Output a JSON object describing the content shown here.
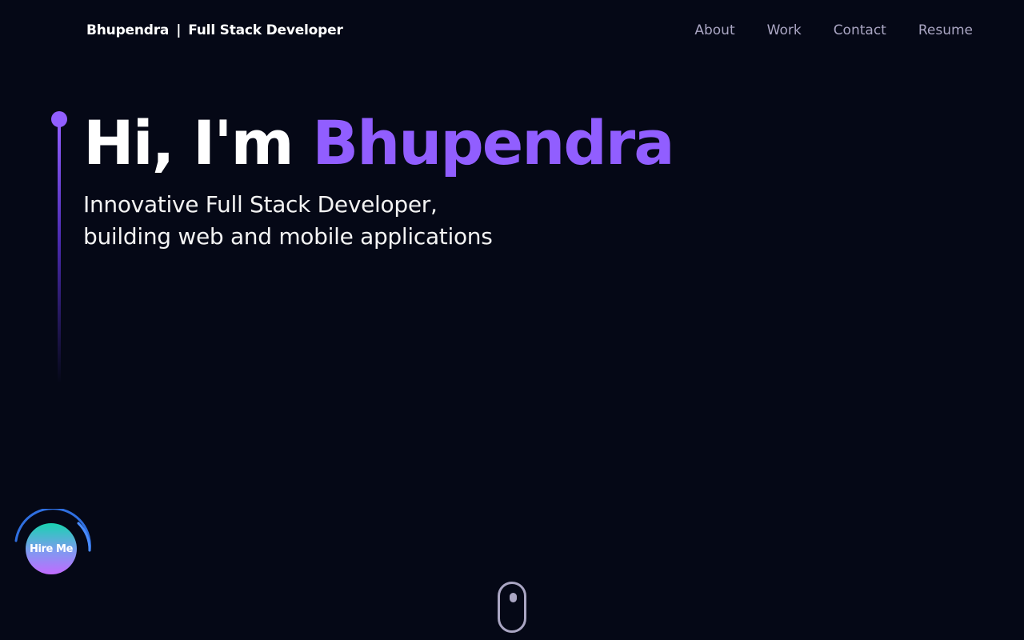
{
  "header": {
    "brand_name": "Bhupendra",
    "brand_separator": "|",
    "brand_role": "Full Stack Developer",
    "nav": [
      {
        "label": "About"
      },
      {
        "label": "Work"
      },
      {
        "label": "Contact"
      },
      {
        "label": "Resume"
      }
    ]
  },
  "hero": {
    "greeting": "Hi, I'm",
    "name": "Bhupendra",
    "subtitle_line1": "Innovative Full Stack Developer,",
    "subtitle_line2": "building web and mobile applications"
  },
  "hire_button": {
    "label": "Hire Me"
  },
  "icons": {
    "scroll": "mouse-scroll-icon"
  },
  "colors": {
    "background": "#050816",
    "accent": "#915eff",
    "nav_text": "#aaa6c3",
    "text": "#ffffff"
  }
}
